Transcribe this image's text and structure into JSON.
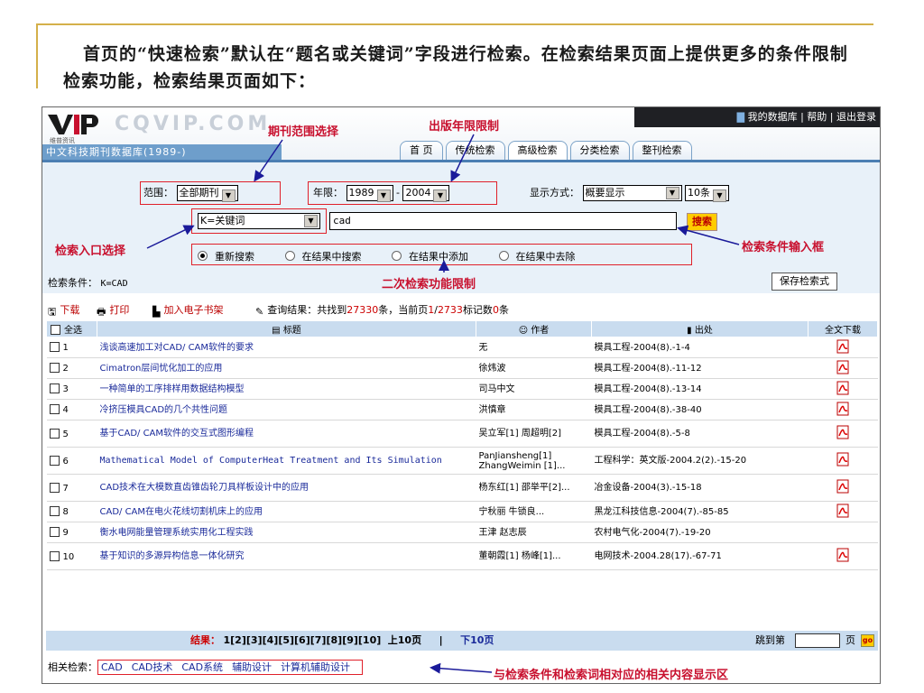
{
  "slide": {
    "heading": "首页的“快速检索”默认在“题名或关键词”字段进行检索。在检索结果页面上提供更多的条件限制检索功能，检索结果页面如下："
  },
  "header": {
    "logo_text": "VIP",
    "logo_sub": "维普资讯",
    "site_name": "CQVIP.COM",
    "db_name": "中文科技期刊数据库(1989-)",
    "top_links": [
      "我的数据库",
      "帮助",
      "退出登录"
    ],
    "tabs": [
      "首 页",
      "传统检索",
      "高级检索",
      "分类检索",
      "整刊检索"
    ]
  },
  "search": {
    "range_label": "范围：",
    "range_value": "全部期刊",
    "year_label": "年限：",
    "year_from": "1989",
    "year_sep": "-",
    "year_to": "2004",
    "display_label": "显示方式：",
    "display_value": "概要显示",
    "page_size": "10条",
    "field_value": "K=关键词",
    "query_value": "cad",
    "search_button": "搜索",
    "modes": [
      "重新搜索",
      "在结果中搜索",
      "在结果中添加",
      "在结果中去除"
    ],
    "condition_label": "检索条件：",
    "condition_value": "K=CAD",
    "save_button": "保存检索式"
  },
  "annotations": {
    "journal_range": "期刊范围选择",
    "year_limit": "出版年限限制",
    "entry_select": "检索入口选择",
    "input_box": "检索条件输入框",
    "secondary": "二次检索功能限制",
    "related_area": "与检索条件和检索词相对应的相关内容显示区"
  },
  "toolbar": {
    "download": "下载",
    "print": "打印",
    "add_shelf": "加入电子书架",
    "query_result_prefix": "查询结果：共找到",
    "total_count": "27330",
    "result_mid": "条，当前页",
    "current_page": "1",
    "page_sep": "/",
    "total_pages": "2733",
    "marked_prefix": "标记数",
    "marked_count": "0",
    "marked_suffix": "条"
  },
  "table": {
    "headers": [
      "全选",
      "标题",
      "作者",
      "出处",
      "全文下载"
    ],
    "rows": [
      {
        "no": "1",
        "title": "浅谈高速加工对CAD/ CAM软件的要求",
        "author": "无",
        "source": "模具工程-2004(8).-1-4",
        "pdf": true
      },
      {
        "no": "2",
        "title": "Cimatron层间忧化加工的应用",
        "author": "徐炜波",
        "source": "模具工程-2004(8).-11-12",
        "pdf": true
      },
      {
        "no": "3",
        "title": "一种简单的工序排样用数据结构模型",
        "author": "司马中文",
        "source": "模具工程-2004(8).-13-14",
        "pdf": true
      },
      {
        "no": "4",
        "title": "冷挤压模具CAD的几个共性问题",
        "author": "洪慎章",
        "source": "模具工程-2004(8).-38-40",
        "pdf": true
      },
      {
        "no": "5",
        "title": "基于CAD/ CAM软件的交互式图形编程",
        "author": "吴立军[1] 周超明[2]",
        "source": "模具工程-2004(8).-5-8",
        "pdf": true
      },
      {
        "no": "6",
        "title": "Mathematical Model of ComputerHeat Treatment and Its Simulation",
        "author": "PanJiansheng[1] ZhangWeimin [1]...",
        "source": "工程科学：英文版-2004.2(2).-15-20",
        "pdf": true
      },
      {
        "no": "7",
        "title": "CAD技术在大模数直齿锥齿轮刀具样板设计中的应用",
        "author": "杨东红[1] 邵举平[2]...",
        "source": "冶金设备-2004(3).-15-18",
        "pdf": true
      },
      {
        "no": "8",
        "title": "CAD/ CAM在电火花线切割机床上的应用",
        "author": "宁秋丽 牛锁良...",
        "source": "黑龙江科技信息-2004(7).-85-85",
        "pdf": true
      },
      {
        "no": "9",
        "title": "衡水电网能量管理系统实用化工程实践",
        "author": "王津 赵志辰",
        "source": "农村电气化-2004(7).-19-20",
        "pdf": false
      },
      {
        "no": "10",
        "title": "基于知识的多源异构信息一体化研究",
        "author": "董朝霞[1] 杨峰[1]...",
        "source": "电网技术-2004.28(17).-67-71",
        "pdf": true
      }
    ]
  },
  "pager": {
    "label": "结果：",
    "current": "1",
    "pages": [
      "[2]",
      "[3]",
      "[4]",
      "[5]",
      "[6]",
      "[7]",
      "[8]",
      "[9]",
      "[10]"
    ],
    "prev10": "上10页",
    "sep": "|",
    "next10": "下10页",
    "jump_label": "跳到第",
    "jump_suffix": "页",
    "go": "go"
  },
  "related": {
    "label": "相关检索：",
    "links": [
      "CAD",
      "CAD技术",
      "CAD系统",
      "辅助设计",
      "计算机辅助设计"
    ]
  },
  "colors": {
    "annotation_red": "#c8102e",
    "header_blue": "#4b7fb3",
    "table_head": "#c9dcef",
    "search_yellow": "#ffcc00"
  }
}
